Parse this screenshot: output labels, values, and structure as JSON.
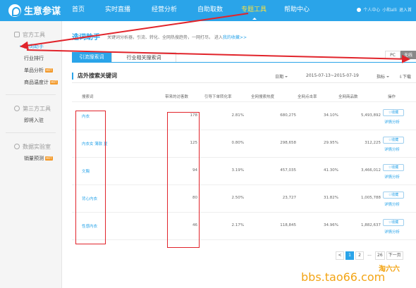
{
  "app": {
    "name": "生意参谋"
  },
  "nav": {
    "items": [
      {
        "label": "首页"
      },
      {
        "label": "实时直播"
      },
      {
        "label": "经营分析"
      },
      {
        "label": "自助取数"
      },
      {
        "label": "专题工具"
      },
      {
        "label": "帮助中心"
      }
    ],
    "active_index": 4
  },
  "user": {
    "center": "个人中心",
    "name": "小和alli",
    "logout": "退入首"
  },
  "sidebar": {
    "groups": [
      {
        "title": "官方工具",
        "items": [
          {
            "label": "选词助手",
            "active": true,
            "hot": false
          },
          {
            "label": "行业排行",
            "hot": false
          },
          {
            "label": "单品分析",
            "hot": true
          },
          {
            "label": "商品温度计",
            "hot": true
          }
        ]
      },
      {
        "title": "第三方工具",
        "items": [
          {
            "label": "即将入驻",
            "hot": false
          }
        ]
      },
      {
        "title": "数据实验室",
        "items": [
          {
            "label": "销量预测",
            "hot": true
          }
        ]
      }
    ],
    "hot_label": "HOT"
  },
  "page": {
    "title": "选词助手",
    "description": "关键词分析器，引流、转化、全网热搜趋势，一网打尽。 进入",
    "description_link": "我的收藏>>"
  },
  "tabs": {
    "active": "引流搜索词",
    "inactive": "行业相关搜索词"
  },
  "device_toggle": {
    "pc": "PC",
    "wireless": "无线"
  },
  "panel": {
    "title": "店外搜索关键词",
    "date_label": "日期",
    "date_range": "2015-07-13~2015-07-19",
    "indicator_label": "指标",
    "download_label": "下载"
  },
  "table": {
    "headers": [
      "搜索词",
      "带来的访客数",
      "引导下单转化率",
      "全网搜索热度",
      "全网点击率",
      "全网商品数",
      "操作"
    ],
    "rows": [
      {
        "keyword": "内衣",
        "visitors": "178",
        "conversion": "2.81%",
        "heat": "680,275",
        "ctr": "34.10%",
        "products": "5,493,892"
      },
      {
        "keyword": "内衣女 薄款 夏",
        "visitors": "125",
        "conversion": "0.80%",
        "heat": "298,658",
        "ctr": "29.95%",
        "products": "312,225"
      },
      {
        "keyword": "文胸",
        "visitors": "94",
        "conversion": "3.19%",
        "heat": "457,035",
        "ctr": "41.30%",
        "products": "3,466,012"
      },
      {
        "keyword": "背心内衣",
        "visitors": "80",
        "conversion": "2.50%",
        "heat": "23,727",
        "ctr": "31.82%",
        "products": "1,005,788"
      },
      {
        "keyword": "性感内衣",
        "visitors": "46",
        "conversion": "2.17%",
        "heat": "118,845",
        "ctr": "34.96%",
        "products": "1,882,637"
      }
    ],
    "fav_label": "收藏",
    "detail_label": "详情分析"
  },
  "pagination": {
    "prev": "<",
    "pages": [
      "1",
      "2"
    ],
    "dots": "...",
    "last": "26",
    "next": "下一页"
  },
  "watermark": {
    "text": "bbs.tao66.com",
    "brand": "淘六六"
  }
}
